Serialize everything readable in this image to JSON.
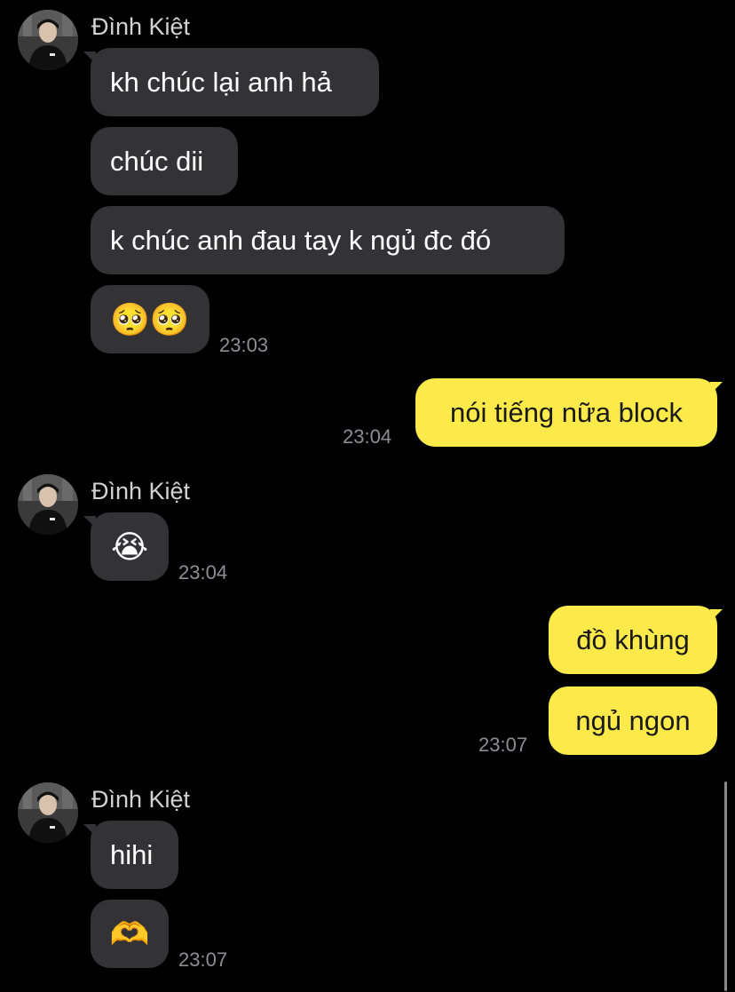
{
  "sender_name": "Đình Kiệt",
  "icons": {
    "avatar": "profile-photo",
    "pleading": "pleading-face-emoji",
    "crying": "loudly-crying-face-emoji",
    "heart_hands": "heart-hands-emoji"
  },
  "colors": {
    "background": "#000000",
    "incoming_bubble": "#333336",
    "outgoing_bubble": "#fce94a",
    "timestamp": "#8e8e93"
  },
  "group1": {
    "messages": [
      "kh chúc lại anh hả",
      "chúc dii",
      "k chúc anh đau tay k ngủ đc đó"
    ],
    "emoji": "🥺🥺",
    "time": "23:03"
  },
  "out1": {
    "message": "nói tiếng nữa block",
    "time": "23:04"
  },
  "group2": {
    "emoji": "😭",
    "time": "23:04"
  },
  "out2": {
    "messages": [
      "đồ khùng",
      "ngủ ngon"
    ],
    "time": "23:07"
  },
  "group3": {
    "messages": [
      "hihi"
    ],
    "emoji": "🫶",
    "time": "23:07"
  }
}
